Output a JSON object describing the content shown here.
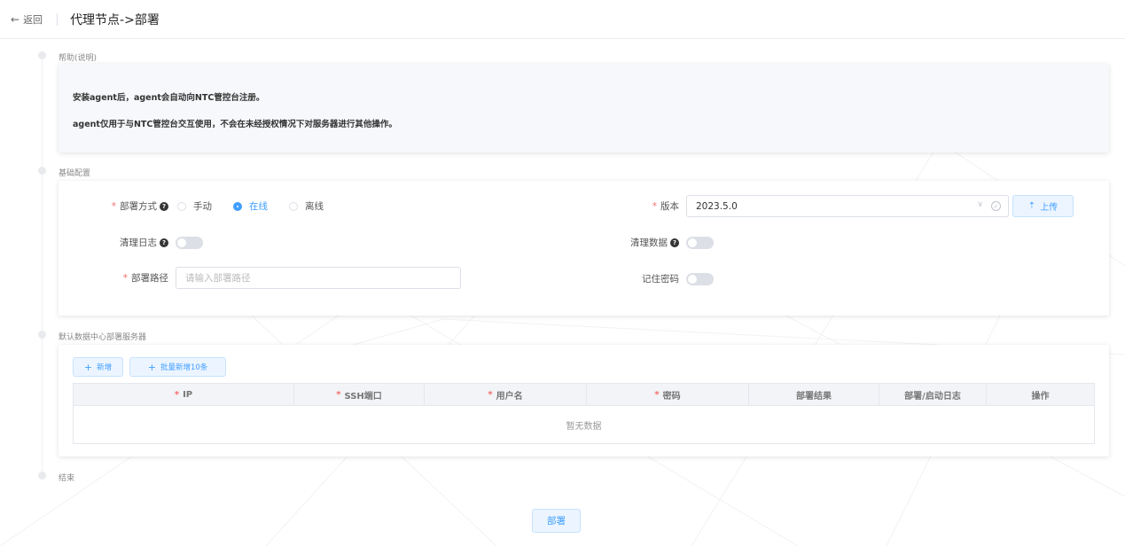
{
  "header": {
    "back_label": "返回",
    "title": "代理节点->部署"
  },
  "sections": {
    "help": "帮助(说明)",
    "basic": "基础配置",
    "servers": "默认数据中心部署服务器",
    "end": "结束"
  },
  "help": {
    "line1": "安装agent后，agent会自动向NTC管控台注册。",
    "line2": "agent仅用于与NTC管控台交互使用，不会在未经授权情况下对服务器进行其他操作。"
  },
  "config": {
    "deploy_method_label": "部署方式",
    "deploy_options": [
      "手动",
      "在线",
      "离线"
    ],
    "deploy_selected": "在线",
    "version_label": "版本",
    "version_value": "2023.5.0",
    "upload_label": "上传",
    "clear_log_label": "清理日志",
    "clear_log_on": false,
    "clear_data_label": "清理数据",
    "clear_data_on": false,
    "path_label": "部署路径",
    "path_placeholder": "请输入部署路径",
    "path_value": "",
    "remember_pwd_label": "记住密码",
    "remember_pwd_on": false
  },
  "servers": {
    "add_label": "新增",
    "batch_add_label": "批量新增10条",
    "columns": [
      {
        "label": "IP",
        "required": true
      },
      {
        "label": "SSH端口",
        "required": true
      },
      {
        "label": "用户名",
        "required": true
      },
      {
        "label": "密码",
        "required": true
      },
      {
        "label": "部署结果",
        "required": false
      },
      {
        "label": "部署/启动日志",
        "required": false
      },
      {
        "label": "操作",
        "required": false
      }
    ],
    "empty_text": "暂无数据"
  },
  "deploy_button_label": "部署",
  "colors": {
    "primary": "#409eff",
    "required": "#f56c6c",
    "help_bg": "#f6f8fb"
  },
  "icons": {
    "back": "arrow-left-icon",
    "help": "question-circle-icon",
    "select": "chevron-down-icon",
    "clear": "circle-check-icon",
    "upload": "upload-icon",
    "add": "plus-icon"
  }
}
